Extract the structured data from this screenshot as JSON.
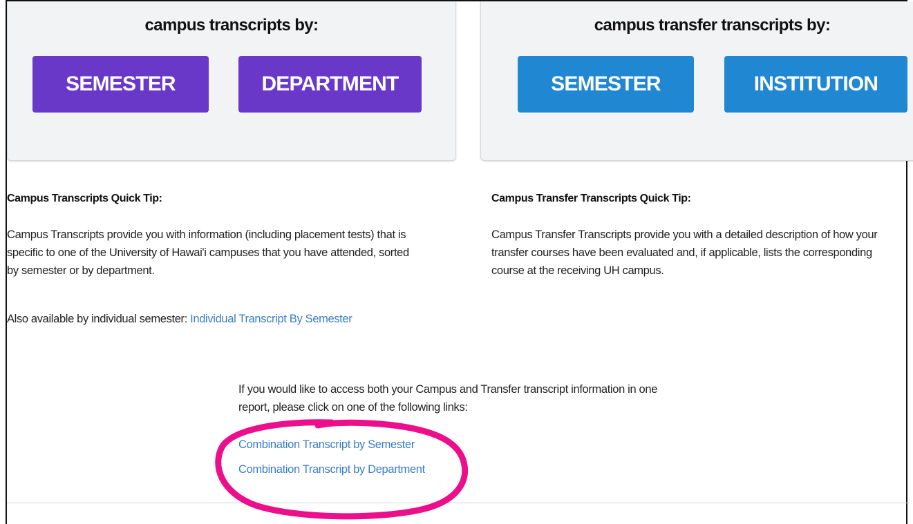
{
  "campus": {
    "panel_title": "campus transcripts by:",
    "semester_button": "SEMESTER",
    "department_button": "DEPARTMENT",
    "tip_heading": "Campus Transcripts Quick Tip:",
    "tip_line1": "Campus Transcripts provide you with information (including placement tests) that is",
    "tip_line2": "specific to one of the University of Hawai'i campuses that you have attended, sorted",
    "tip_line3": "by semester or by department.",
    "also_available_text": "Also available by individual semester: ",
    "individual_link": "Individual Transcript By Semester"
  },
  "transfer": {
    "panel_title": "campus transfer transcripts by:",
    "semester_button": "SEMESTER",
    "institution_button": "INSTITUTION",
    "tip_heading": "Campus Transfer Transcripts Quick Tip:",
    "tip_line1": "Campus Transfer Transcripts provide you with a detailed description of how your",
    "tip_line2": "transfer courses have been evaluated and, if applicable, lists the corresponding",
    "tip_line3": "course at the receiving UH campus."
  },
  "combination": {
    "intro_line1": "If you would like to access both your Campus and Transfer transcript information in one",
    "intro_line2": "report, please click on one of the following links:",
    "by_semester_link": "Combination Transcript by Semester",
    "by_department_link": "Combination Transcript by Department"
  },
  "colors": {
    "campus_button": "#6a38c9",
    "transfer_button": "#2087d2",
    "link": "#3a7ec9",
    "highlight_annotation": "#ec0f8c"
  }
}
